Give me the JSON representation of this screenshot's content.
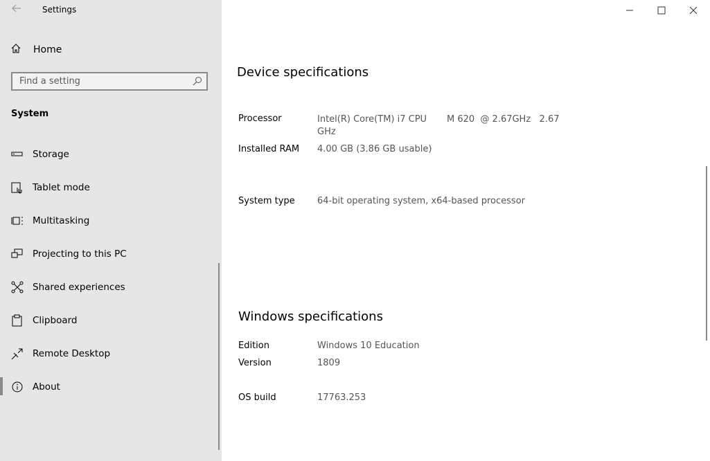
{
  "app": {
    "title": "Settings"
  },
  "sidebar": {
    "home_label": "Home",
    "search_placeholder": "Find a setting",
    "section": "System",
    "items": [
      {
        "label": "Storage",
        "icon": "storage-icon"
      },
      {
        "label": "Tablet mode",
        "icon": "tablet-mode-icon"
      },
      {
        "label": "Multitasking",
        "icon": "multitasking-icon"
      },
      {
        "label": "Projecting to this PC",
        "icon": "projecting-icon"
      },
      {
        "label": "Shared experiences",
        "icon": "shared-experiences-icon"
      },
      {
        "label": "Clipboard",
        "icon": "clipboard-icon"
      },
      {
        "label": "Remote Desktop",
        "icon": "remote-desktop-icon"
      },
      {
        "label": "About",
        "icon": "about-icon",
        "selected": true
      }
    ]
  },
  "device_specs": {
    "heading": "Device specifications",
    "processor_label": "Processor",
    "processor_value_line1": "Intel(R) Core(TM) i7 CPU       M 620  @ 2.67GHz   2.67",
    "processor_value_line2": "GHz",
    "ram_label": "Installed RAM",
    "ram_value": "4.00 GB (3.86 GB usable)",
    "system_type_label": "System type",
    "system_type_value": "64-bit operating system, x64-based processor"
  },
  "windows_specs": {
    "heading": "Windows specifications",
    "edition_label": "Edition",
    "edition_value": "Windows 10 Education",
    "version_label": "Version",
    "version_value": "1809",
    "os_build_label": "OS build",
    "os_build_value": "17763.253"
  }
}
